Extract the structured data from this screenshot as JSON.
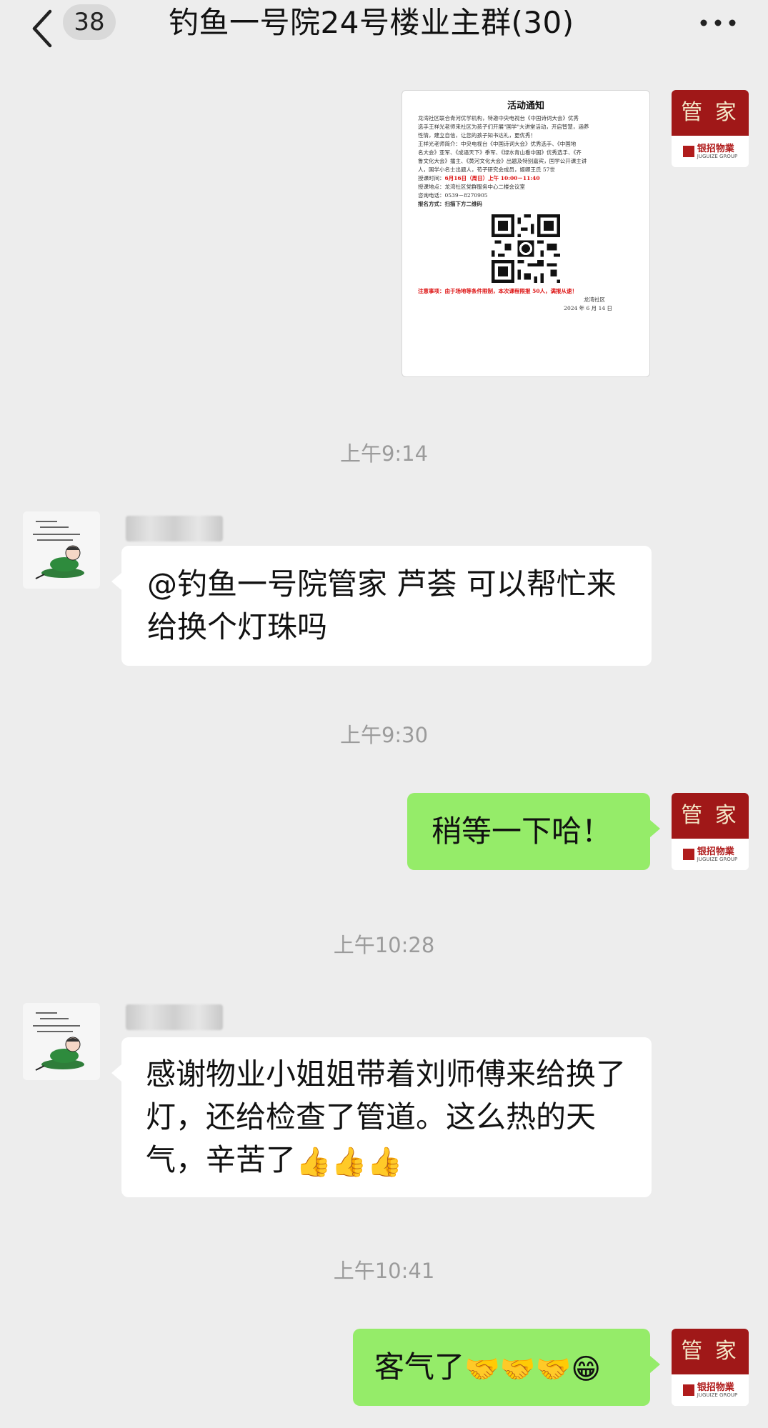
{
  "header": {
    "unread_count": "38",
    "title": "钓鱼一号院24号楼业主群(30)"
  },
  "avatars": {
    "manager_top": "管 家",
    "manager_brand": "银招物業",
    "manager_brand_sub": "JUGUIZE GROUP"
  },
  "notice": {
    "title": "活动通知",
    "lines": [
      "龙湾社区联合青河优学机构，特邀中央电视台《中国诗词大会》优秀",
      "选手王祥光老师来社区为孩子们开展\"国学\"大讲堂活动，开启智慧，涵养",
      "性情，建立自信，让您的孩子知书达礼，更优秀！",
      "王祥光老师简介：中央电视台《中国诗词大会》优秀选手、《中国地",
      "名大会》亚军、《成语天下》季军、《绿水青山看中国》优秀选手、《齐",
      "鲁文化大会》擂主、《黄河文化大会》出题及特别嘉宾，国学公开课主讲",
      "人，国学小名士出题人，苟子研究会成员，姬卿王氏 57世"
    ],
    "time_label": "授课时间：",
    "time_value": "6月16日（周日）上午 10:00－11:40",
    "place": "授课地点：龙湾社区党群服务中心二楼会议室",
    "phone": "咨询电话：0539－8270905",
    "signup": "报名方式：扫描下方二维码",
    "caution": "注意事项：由于场地等条件限制，本次课程限报 50人，满报从速！",
    "org": "龙湾社区",
    "date": "2024 年 6 月 14 日"
  },
  "messages": {
    "time1": "上午9:14",
    "msg1": "@钓鱼一号院管家 芦荟  可以帮忙来给换个灯珠吗",
    "time2": "上午9:30",
    "msg2": "稍等一下哈！",
    "time3": "上午10:28",
    "msg3": "感谢物业小姐姐带着刘师傅来给换了灯，还给检查了管道。这么热的天气，辛苦了",
    "msg3_emoji": "👍👍👍",
    "time4": "上午10:41",
    "msg4": "客气了",
    "msg4_emoji": "🤝🤝🤝😁"
  },
  "colors": {
    "background": "#ededed",
    "own_bubble": "#95ec69",
    "other_bubble": "#ffffff",
    "manager_red": "#a01818"
  },
  "icons": [
    "back-chevron-icon",
    "more-dots-icon",
    "qr-code-icon"
  ]
}
